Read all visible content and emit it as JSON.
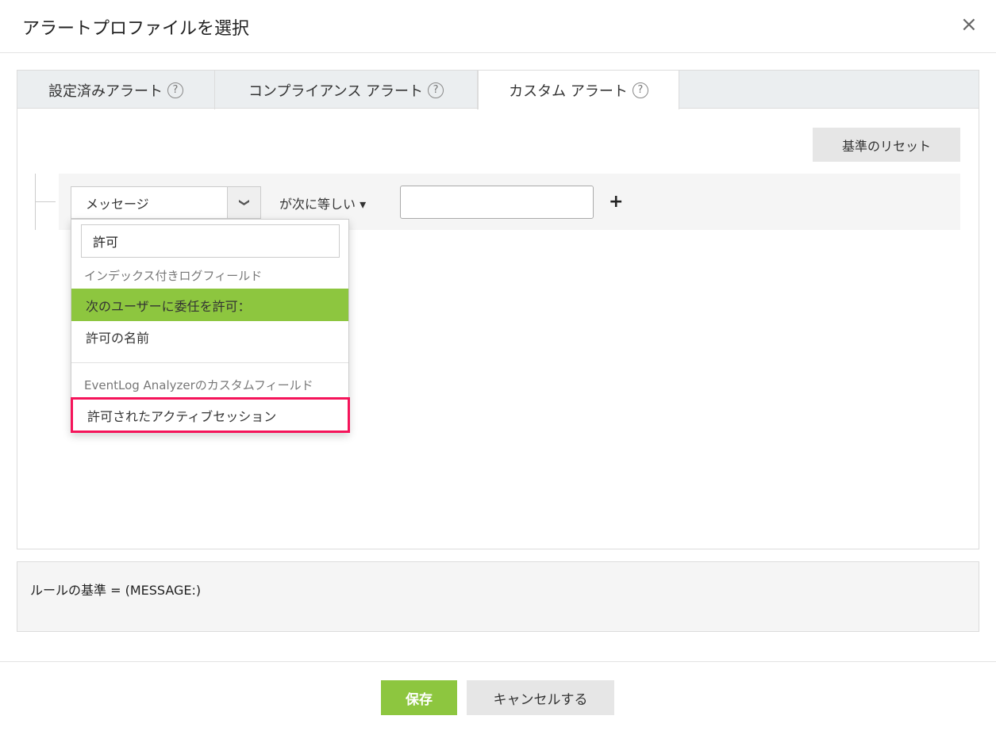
{
  "dialog": {
    "title": "アラートプロファイルを選択",
    "close": "×"
  },
  "tabs": [
    {
      "label": "設定済みアラート",
      "help": "?"
    },
    {
      "label": "コンプライアンス アラート",
      "help": "?"
    },
    {
      "label": "カスタム アラート",
      "help": "?"
    }
  ],
  "reset_label": "基準のリセット",
  "criteria": {
    "field": "メッセージ",
    "chevron": "❯",
    "operator": "が次に等しい ▾",
    "value": "",
    "plus": "+"
  },
  "dropdown": {
    "search_value": "許可",
    "group1": "インデックス付きログフィールド",
    "options1": [
      "次のユーザーに委任を許可：",
      "許可の名前"
    ],
    "group2": "EventLog Analyzerのカスタムフィールド",
    "options2": [
      "許可されたアクティブセッション"
    ]
  },
  "rule_text": "ルールの基準 = (MESSAGE:)",
  "footer": {
    "save": "保存",
    "cancel": "キャンセルする"
  }
}
